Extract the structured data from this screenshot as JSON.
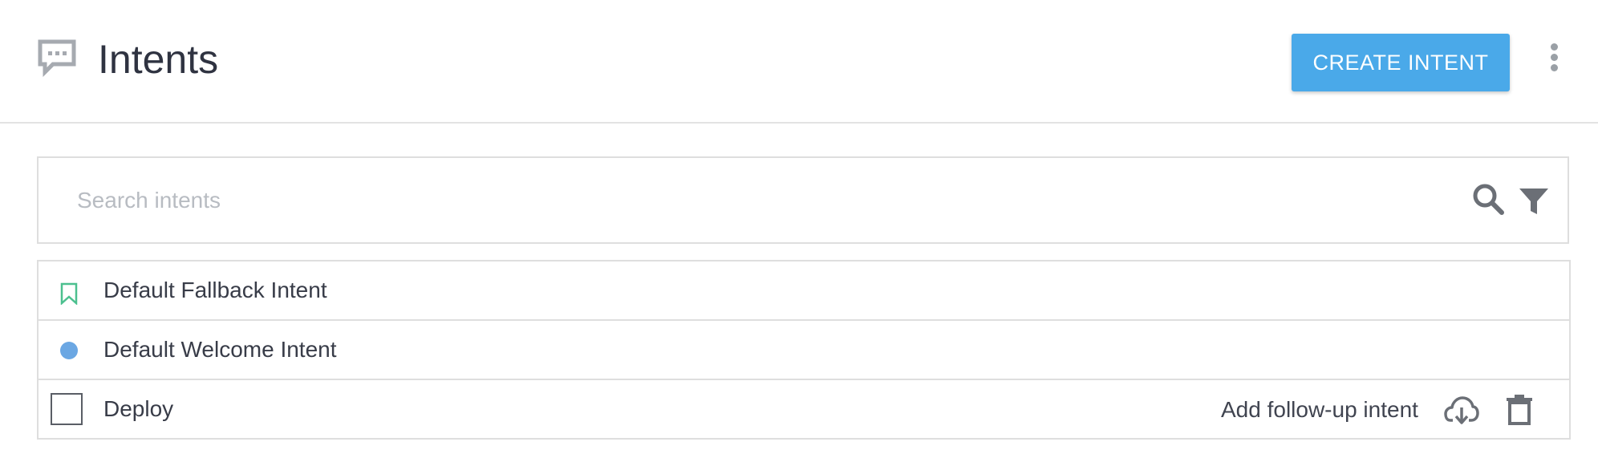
{
  "header": {
    "title": "Intents",
    "icon": "chat-bubble-icon",
    "create_button_label": "CREATE INTENT",
    "more_icon": "more-vertical-icon"
  },
  "search": {
    "placeholder": "Search intents",
    "value": "",
    "search_icon": "search-icon",
    "filter_icon": "filter-icon"
  },
  "intents": [
    {
      "name": "Default Fallback Intent",
      "marker": "bookmark-icon",
      "marker_color": "#4cc08f"
    },
    {
      "name": "Default Welcome Intent",
      "marker": "dot-icon",
      "marker_color": "#6ba7e3"
    },
    {
      "name": "Deploy",
      "marker": "checkbox",
      "followup_label": "Add follow-up intent",
      "actions": [
        "cloud-download-icon",
        "trash-icon"
      ]
    }
  ],
  "colors": {
    "accent": "#4aa9e9",
    "border": "#dedede",
    "icon_gray": "#9aa0a6",
    "text": "#333844"
  }
}
